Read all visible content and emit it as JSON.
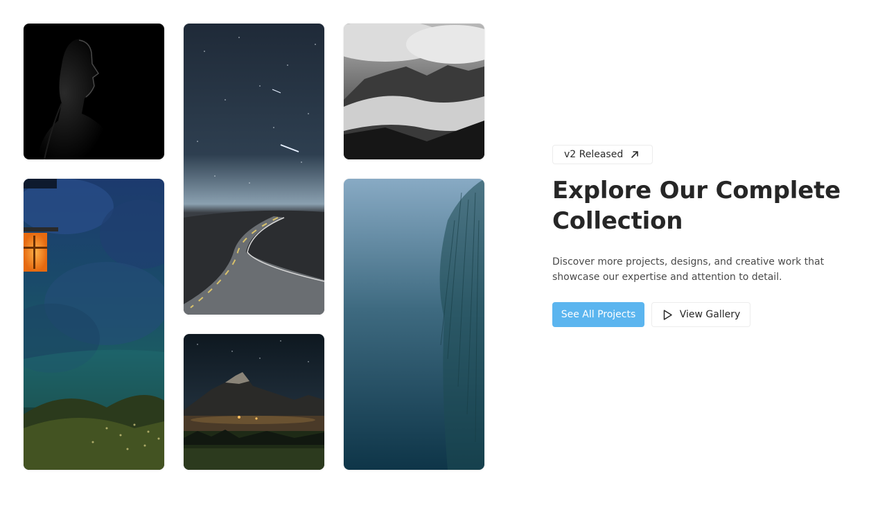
{
  "gallery": {
    "images": [
      {
        "icon": "portrait-photo",
        "alt": ""
      },
      {
        "icon": "forest-lantern-photo",
        "alt": ""
      },
      {
        "icon": "night-road-photo",
        "alt": ""
      },
      {
        "icon": "mountain-night-photo",
        "alt": ""
      },
      {
        "icon": "cloudy-mountains-photo",
        "alt": ""
      },
      {
        "icon": "foggy-willow-photo",
        "alt": ""
      }
    ]
  },
  "hero": {
    "badge_label": "v2 Released",
    "title": "Explore Our Complete Collection",
    "description": "Discover more projects, designs, and creative work that showcase our expertise and attention to detail.",
    "primary_button": "See All Projects",
    "secondary_button": "View Gallery"
  },
  "colors": {
    "accent": "#5bb5ef",
    "text": "#262626",
    "muted_text": "#4a4a4a",
    "border": "#ececec"
  }
}
